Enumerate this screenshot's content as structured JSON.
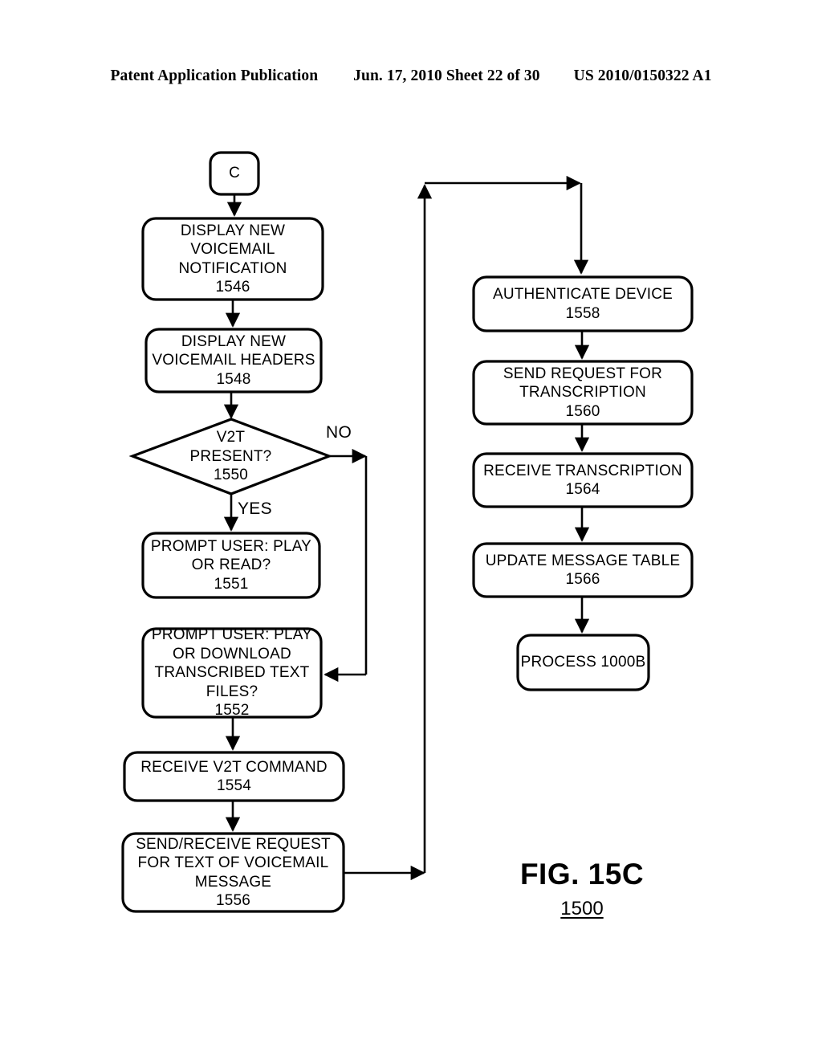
{
  "header": {
    "left": "Patent Application Publication",
    "middle": "Jun. 17, 2010  Sheet 22 of 30",
    "right": "US 2010/0150322 A1"
  },
  "figure": {
    "title": "FIG. 15C",
    "number": "1500"
  },
  "connector": {
    "label": "C"
  },
  "branches": {
    "no": "NO",
    "yes": "YES"
  },
  "nodes": {
    "n1546": {
      "text": "DISPLAY NEW\nVOICEMAIL\nNOTIFICATION",
      "ref": "1546"
    },
    "n1548": {
      "text": "DISPLAY NEW\nVOICEMAIL HEADERS",
      "ref": "1548"
    },
    "n1550": {
      "text": "V2T\nPRESENT?",
      "ref": "1550"
    },
    "n1551": {
      "text": "PROMPT USER: PLAY\nOR READ?",
      "ref": "1551"
    },
    "n1552": {
      "text": "PROMPT USER: PLAY\nOR DOWNLOAD\nTRANSCRIBED TEXT\nFILES?",
      "ref": "1552"
    },
    "n1554": {
      "text": "RECEIVE V2T COMMAND",
      "ref": "1554"
    },
    "n1556": {
      "text": "SEND/RECEIVE REQUEST\nFOR TEXT OF VOICEMAIL\nMESSAGE",
      "ref": "1556"
    },
    "n1558": {
      "text": "AUTHENTICATE DEVICE",
      "ref": "1558"
    },
    "n1560": {
      "text": "SEND REQUEST FOR\nTRANSCRIPTION",
      "ref": "1560"
    },
    "n1564": {
      "text": "RECEIVE TRANSCRIPTION",
      "ref": "1564"
    },
    "n1566": {
      "text": "UPDATE MESSAGE TABLE",
      "ref": "1566"
    },
    "n1000b": {
      "text": "PROCESS 1000B",
      "ref": ""
    }
  },
  "style": {
    "stroke": "#000000",
    "fill": "#ffffff"
  }
}
